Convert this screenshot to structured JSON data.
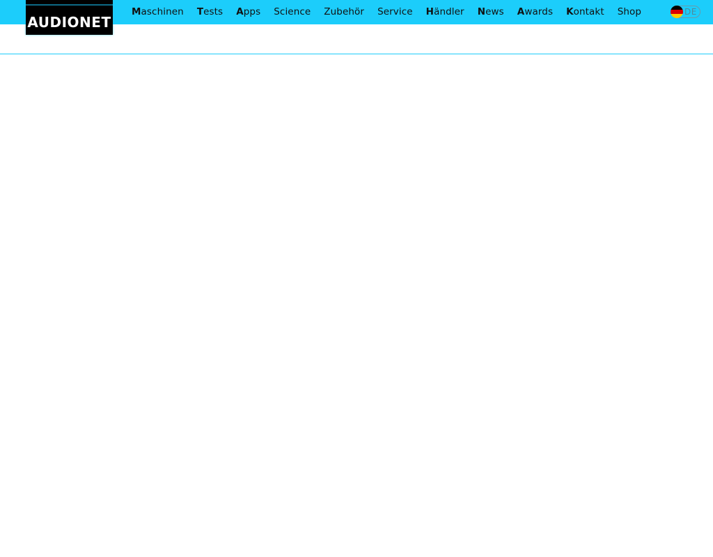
{
  "header": {
    "logo_text": "AUDIONET",
    "nav_items": [
      {
        "first": "M",
        "rest": "aschinen"
      },
      {
        "first": "T",
        "rest": "ests"
      },
      {
        "first": "A",
        "rest": "pps"
      },
      {
        "first": "S",
        "rest": "cience"
      },
      {
        "first": "Z",
        "rest": "ubehör"
      },
      {
        "first": "S",
        "rest": "ervice"
      },
      {
        "first": "H",
        "rest": "ändler"
      },
      {
        "first": "N",
        "rest": "ews"
      },
      {
        "first": "A",
        "rest": "wards"
      },
      {
        "first": "K",
        "rest": "ontakt"
      },
      {
        "first": "S",
        "rest": "hop"
      }
    ],
    "language": {
      "label": "DE",
      "flag_icon": "germany-flag-icon"
    }
  },
  "colors": {
    "brand_cyan": "#1ccdfb",
    "logo_bg": "#000000",
    "nav_text": "#111111"
  }
}
